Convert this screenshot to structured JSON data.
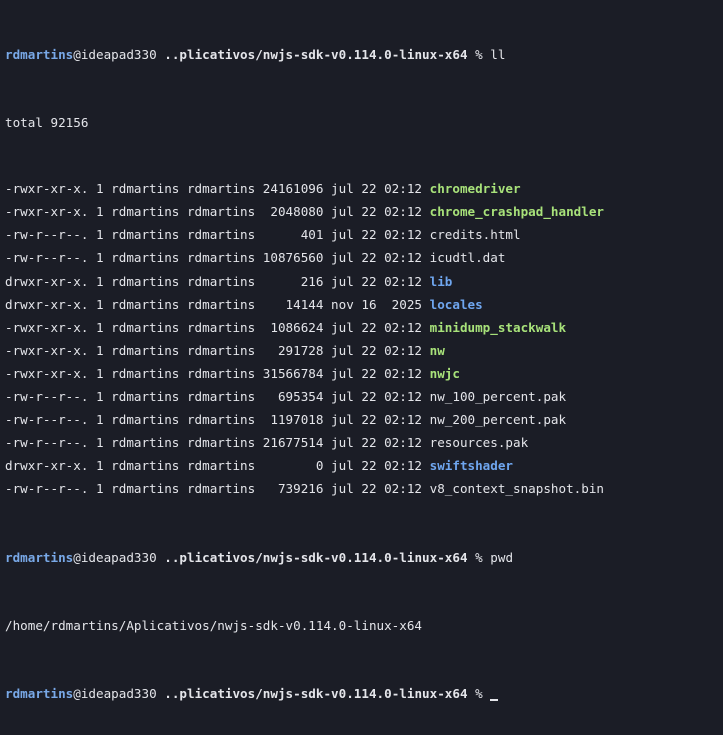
{
  "prompts": [
    {
      "user": "rdmartins",
      "host": "@ideapad330",
      "path": " ..plicativos/nwjs-sdk-v0.114.0-linux-x64",
      "symbol": " % ",
      "command": "ll"
    },
    {
      "user": "rdmartins",
      "host": "@ideapad330",
      "path": " ..plicativos/nwjs-sdk-v0.114.0-linux-x64",
      "symbol": " % ",
      "command": "pwd"
    },
    {
      "user": "rdmartins",
      "host": "@ideapad330",
      "path": " ..plicativos/nwjs-sdk-v0.114.0-linux-x64",
      "symbol": " % ",
      "command": ""
    }
  ],
  "total_line": "total 92156",
  "pwd_output": "/home/rdmartins/Aplicativos/nwjs-sdk-v0.114.0-linux-x64",
  "entries": [
    {
      "meta": "-rwxr-xr-x. 1 rdmartins rdmartins 24161096 jul 22 02:12 ",
      "name": "chromedriver",
      "kind": "exec"
    },
    {
      "meta": "-rwxr-xr-x. 1 rdmartins rdmartins  2048080 jul 22 02:12 ",
      "name": "chrome_crashpad_handler",
      "kind": "exec"
    },
    {
      "meta": "-rw-r--r--. 1 rdmartins rdmartins      401 jul 22 02:12 ",
      "name": "credits.html",
      "kind": "plain"
    },
    {
      "meta": "-rw-r--r--. 1 rdmartins rdmartins 10876560 jul 22 02:12 ",
      "name": "icudtl.dat",
      "kind": "plain"
    },
    {
      "meta": "drwxr-xr-x. 1 rdmartins rdmartins      216 jul 22 02:12 ",
      "name": "lib",
      "kind": "dir"
    },
    {
      "meta": "drwxr-xr-x. 1 rdmartins rdmartins    14144 nov 16  2025 ",
      "name": "locales",
      "kind": "dir"
    },
    {
      "meta": "-rwxr-xr-x. 1 rdmartins rdmartins  1086624 jul 22 02:12 ",
      "name": "minidump_stackwalk",
      "kind": "exec"
    },
    {
      "meta": "-rwxr-xr-x. 1 rdmartins rdmartins   291728 jul 22 02:12 ",
      "name": "nw",
      "kind": "exec"
    },
    {
      "meta": "-rwxr-xr-x. 1 rdmartins rdmartins 31566784 jul 22 02:12 ",
      "name": "nwjc",
      "kind": "exec"
    },
    {
      "meta": "-rw-r--r--. 1 rdmartins rdmartins   695354 jul 22 02:12 ",
      "name": "nw_100_percent.pak",
      "kind": "plain"
    },
    {
      "meta": "-rw-r--r--. 1 rdmartins rdmartins  1197018 jul 22 02:12 ",
      "name": "nw_200_percent.pak",
      "kind": "plain"
    },
    {
      "meta": "-rw-r--r--. 1 rdmartins rdmartins 21677514 jul 22 02:12 ",
      "name": "resources.pak",
      "kind": "plain"
    },
    {
      "meta": "drwxr-xr-x. 1 rdmartins rdmartins        0 jul 22 02:12 ",
      "name": "swiftshader",
      "kind": "dir"
    },
    {
      "meta": "-rw-r--r--. 1 rdmartins rdmartins   739216 jul 22 02:12 ",
      "name": "v8_context_snapshot.bin",
      "kind": "plain"
    }
  ],
  "colors": {
    "background": "#1b1d26",
    "text": "#e4e5ea",
    "user": "#79a9e8",
    "executable": "#a8e27a",
    "directory": "#6fa6ef"
  }
}
